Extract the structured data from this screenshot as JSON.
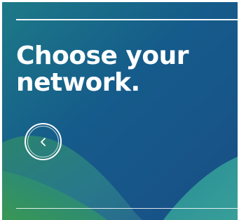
{
  "page": {
    "headline": "Choose your network."
  },
  "controls": {
    "back_icon": "chevron-left-icon"
  },
  "colors": {
    "text": "#ffffff",
    "background_top": "#174f86",
    "background_mid": "#1d6f8c",
    "accent_green": "#3e9a5a",
    "accent_teal": "#2f9a95"
  }
}
